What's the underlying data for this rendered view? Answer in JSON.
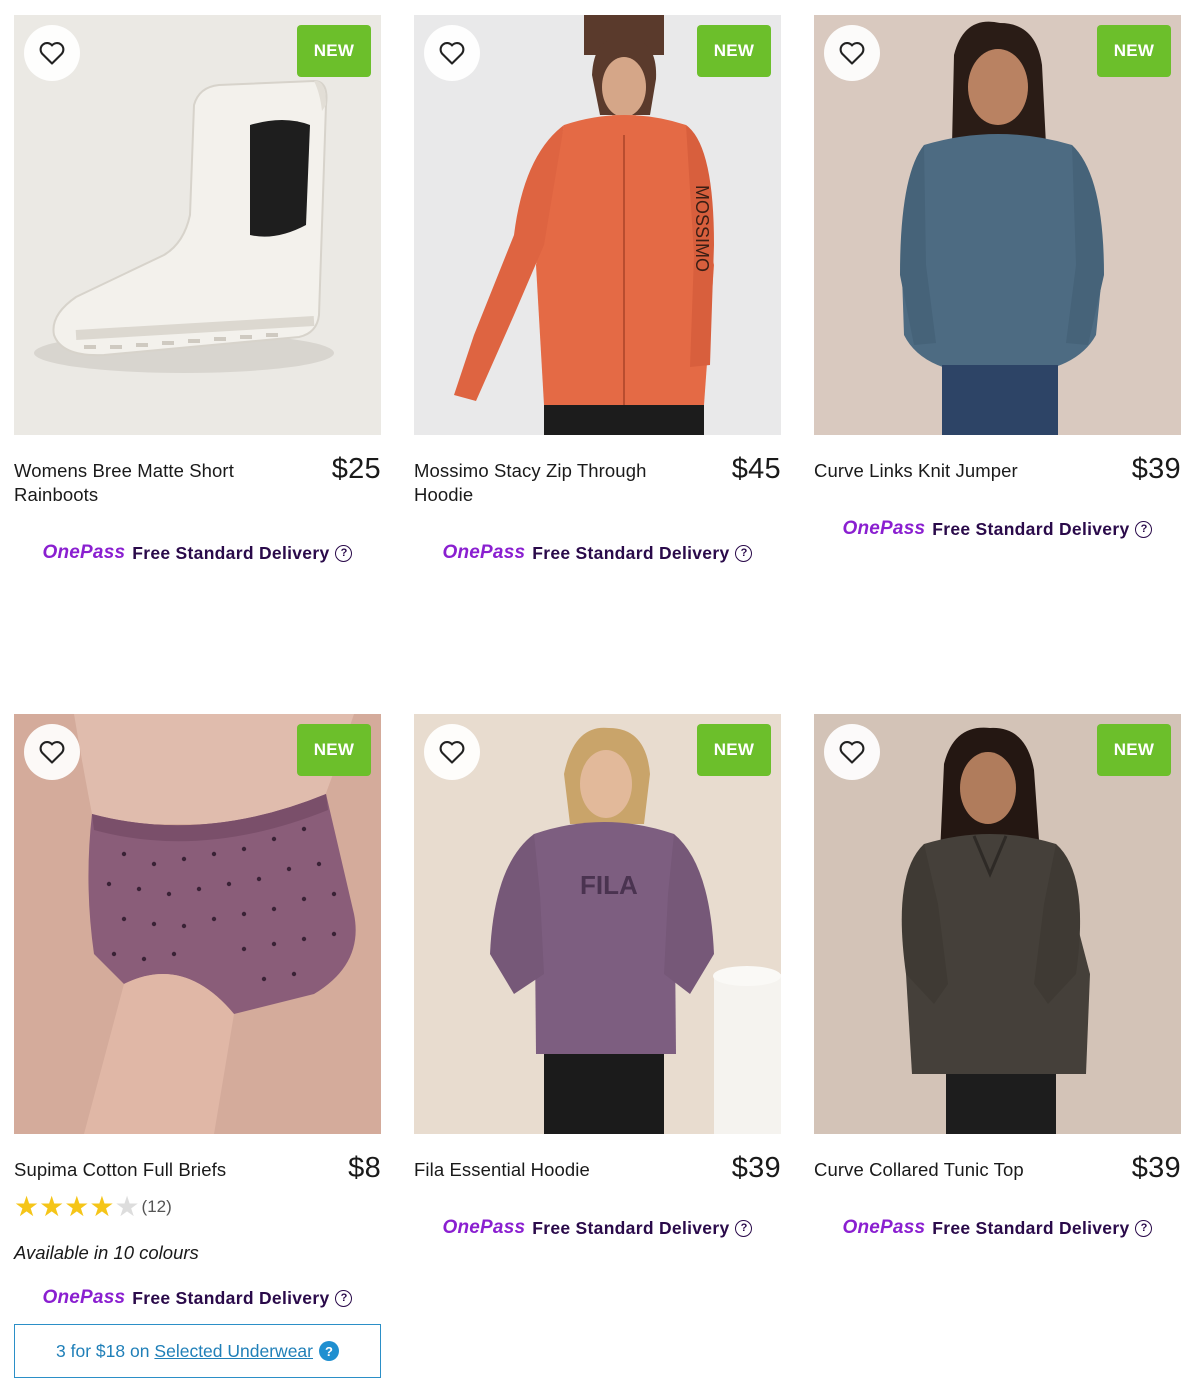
{
  "products": [
    {
      "title": "Womens Bree Matte Short Rainboots",
      "price": "$25",
      "badge": "NEW",
      "image": "white-chelsea-rainboot",
      "onepass_logo": "OnePass",
      "delivery": "Free Standard Delivery"
    },
    {
      "title": "Mossimo Stacy Zip Through Hoodie",
      "price": "$45",
      "badge": "NEW",
      "image": "orange-zip-hoodie",
      "onepass_logo": "OnePass",
      "delivery": "Free Standard Delivery"
    },
    {
      "title": "Curve Links Knit Jumper",
      "price": "$39",
      "badge": "NEW",
      "image": "blue-knit-jumper",
      "onepass_logo": "OnePass",
      "delivery": "Free Standard Delivery"
    },
    {
      "title": "Supima Cotton Full Briefs",
      "price": "$8",
      "badge": "NEW",
      "image": "purple-polka-dot-briefs",
      "rating": 4,
      "rating_max": 5,
      "reviews": "(12)",
      "colours": "Available in 10 colours",
      "onepass_logo": "OnePass",
      "delivery": "Free Standard Delivery",
      "promo_prefix": "3 for $18 on",
      "promo_link": "Selected Underwear"
    },
    {
      "title": "Fila Essential Hoodie",
      "price": "$39",
      "badge": "NEW",
      "image": "purple-fila-hoodie",
      "onepass_logo": "OnePass",
      "delivery": "Free Standard Delivery"
    },
    {
      "title": "Curve Collared Tunic Top",
      "price": "$39",
      "badge": "NEW",
      "image": "dark-collared-tunic",
      "onepass_logo": "OnePass",
      "delivery": "Free Standard Delivery"
    }
  ],
  "colors": {
    "badge_green": "#6cbf2b",
    "onepass_purple": "#8a1fd0",
    "delivery_text": "#2a0a4a",
    "promo_blue": "#1f7fb8",
    "star_gold": "#f5c518"
  },
  "icons": {
    "favourite": "heart-outline-icon",
    "help": "question-circle-icon"
  }
}
